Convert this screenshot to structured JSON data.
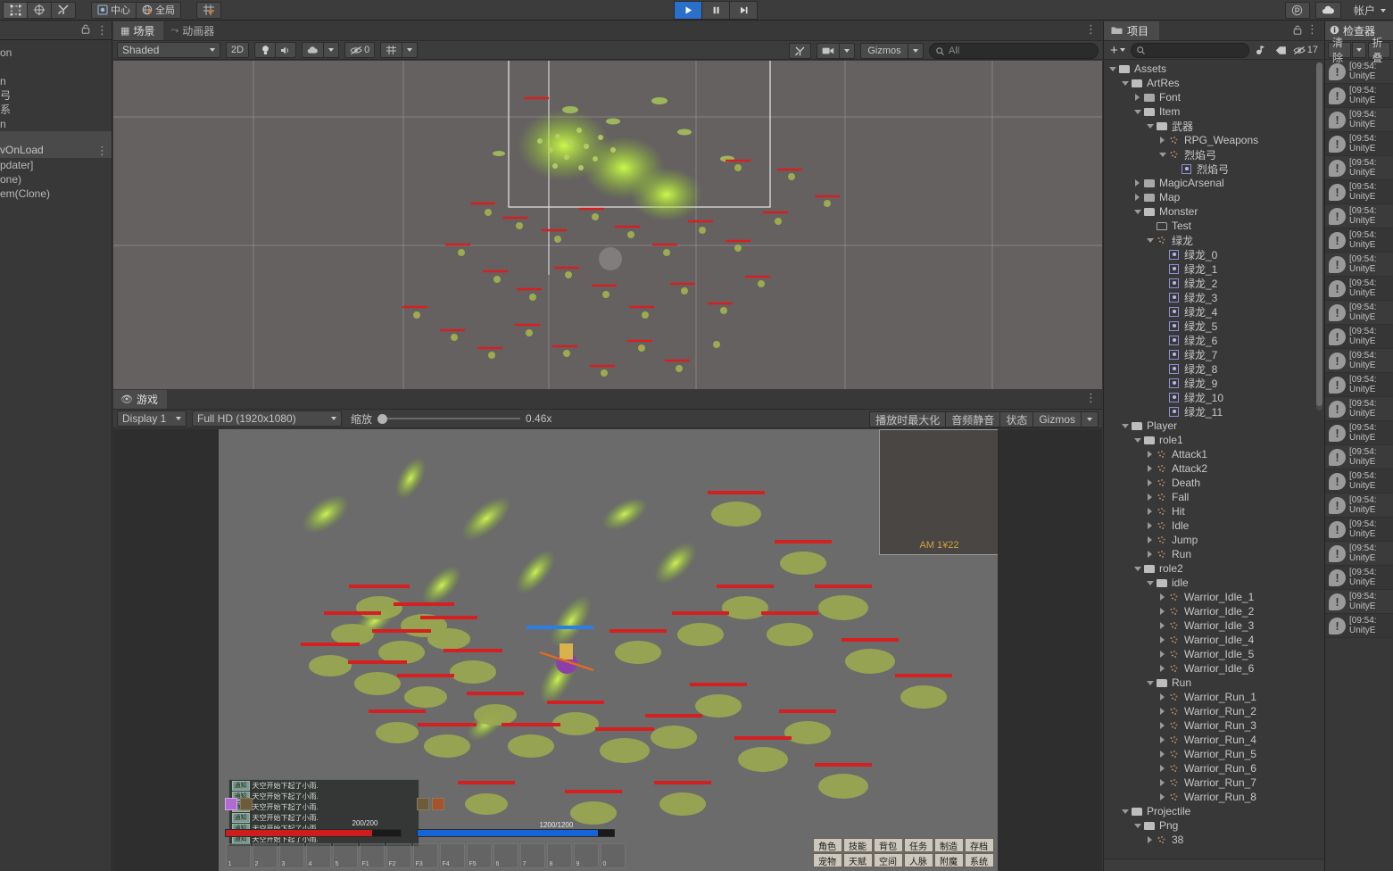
{
  "topbar": {
    "tools": [
      {
        "name": "rect-transform-tool",
        "icon": "▣"
      },
      {
        "name": "move-tool",
        "icon": "✥"
      },
      {
        "name": "custom-tool",
        "icon": "✂"
      }
    ],
    "pivot_label": "中心",
    "space_label": "全局",
    "grid_label": "▦",
    "play_icon": "▶",
    "pause_icon": "❚❚",
    "step_icon": "▶❙",
    "collab_icon": "◎",
    "cloud_icon": "☁",
    "account_label": "帐户"
  },
  "left_panel": {
    "rows_top": [
      "on",
      "",
      "n",
      "弓",
      "系",
      "n"
    ],
    "selected_row": "",
    "section_label": "vOnLoad",
    "rows_bottom": [
      "pdater]",
      "one)",
      "em(Clone)"
    ]
  },
  "scene_view": {
    "tabs": [
      {
        "label": "场景",
        "icon": "scene-icon",
        "active": true
      },
      {
        "label": "动画器",
        "icon": "animator-icon",
        "active": false
      }
    ],
    "shading_mode": "Shaded",
    "mode_2d": "2D",
    "lighting_icon": "💡",
    "audio_icon": "🔊",
    "fx_icon": "☁",
    "hidden_count": "0",
    "grid_icon": "▦",
    "gizmos_label": "Gizmos",
    "search_placeholder": "All",
    "search_value": "",
    "tool_icon": "✂",
    "camera_icon": "▮"
  },
  "game_view": {
    "tab_label": "游戏",
    "display": "Display 1",
    "resolution": "Full HD (1920x1080)",
    "zoom_label": "缩放",
    "zoom_value": "0.46x",
    "maximize_label": "播放时最大化",
    "mute_label": "音频静音",
    "stats_label": "状态",
    "gizmos_label": "Gizmos",
    "hud": {
      "minimap_label": "AM 1¥22",
      "chat_messages": [
        {
          "badge": "通知",
          "text": "天空开始下起了小雨."
        },
        {
          "badge": "通知",
          "text": "天空开始下起了小雨."
        },
        {
          "badge": "通知",
          "text": "天空开始下起了小雨."
        },
        {
          "badge": "通知",
          "text": "天空开始下起了小雨."
        },
        {
          "badge": "通知",
          "text": "天空开始下起了小雨."
        },
        {
          "badge": "通知",
          "text": "天空开始下起了小雨."
        }
      ],
      "hp_text": "200/200",
      "mp_text": "1200/1200",
      "skill_keys": [
        "1",
        "2",
        "3",
        "4",
        "5",
        "F1",
        "F2",
        "F3",
        "F4",
        "F5",
        "6",
        "7",
        "8",
        "9",
        "0"
      ],
      "menu_buttons": [
        "角色",
        "技能",
        "背包",
        "任务",
        "制造",
        "存档",
        "宠物",
        "天赋",
        "空间",
        "人脉",
        "附魔",
        "系统"
      ]
    }
  },
  "project_panel": {
    "tab_label": "项目",
    "search_placeholder": "",
    "search_value": "",
    "hidden_count": "17",
    "tree": [
      {
        "depth": 0,
        "label": "Assets",
        "type": "folder-open",
        "expanded": true
      },
      {
        "depth": 1,
        "label": "ArtRes",
        "type": "folder-open",
        "expanded": true
      },
      {
        "depth": 2,
        "label": "Font",
        "type": "folder",
        "expanded": false
      },
      {
        "depth": 2,
        "label": "Item",
        "type": "folder-open",
        "expanded": true
      },
      {
        "depth": 3,
        "label": "武器",
        "type": "folder-open",
        "expanded": true
      },
      {
        "depth": 4,
        "label": "RPG_Weapons",
        "type": "fx",
        "expanded": false
      },
      {
        "depth": 4,
        "label": "烈焰弓",
        "type": "fx",
        "expanded": true
      },
      {
        "depth": 5,
        "label": "烈焰弓",
        "type": "prefab",
        "expanded": null
      },
      {
        "depth": 2,
        "label": "MagicArsenal",
        "type": "folder",
        "expanded": false
      },
      {
        "depth": 2,
        "label": "Map",
        "type": "folder",
        "expanded": false
      },
      {
        "depth": 2,
        "label": "Monster",
        "type": "folder-open",
        "expanded": true
      },
      {
        "depth": 3,
        "label": "Test",
        "type": "folder-hollow",
        "expanded": null
      },
      {
        "depth": 3,
        "label": "绿龙",
        "type": "fx",
        "expanded": true
      },
      {
        "depth": 4,
        "label": "绿龙_0",
        "type": "prefab",
        "expanded": null
      },
      {
        "depth": 4,
        "label": "绿龙_1",
        "type": "prefab",
        "expanded": null
      },
      {
        "depth": 4,
        "label": "绿龙_2",
        "type": "prefab",
        "expanded": null
      },
      {
        "depth": 4,
        "label": "绿龙_3",
        "type": "prefab",
        "expanded": null
      },
      {
        "depth": 4,
        "label": "绿龙_4",
        "type": "prefab",
        "expanded": null
      },
      {
        "depth": 4,
        "label": "绿龙_5",
        "type": "prefab",
        "expanded": null
      },
      {
        "depth": 4,
        "label": "绿龙_6",
        "type": "prefab",
        "expanded": null
      },
      {
        "depth": 4,
        "label": "绿龙_7",
        "type": "prefab",
        "expanded": null
      },
      {
        "depth": 4,
        "label": "绿龙_8",
        "type": "prefab",
        "expanded": null
      },
      {
        "depth": 4,
        "label": "绿龙_9",
        "type": "prefab",
        "expanded": null
      },
      {
        "depth": 4,
        "label": "绿龙_10",
        "type": "prefab",
        "expanded": null
      },
      {
        "depth": 4,
        "label": "绿龙_11",
        "type": "prefab",
        "expanded": null
      },
      {
        "depth": 1,
        "label": "Player",
        "type": "folder-open",
        "expanded": true
      },
      {
        "depth": 2,
        "label": "role1",
        "type": "folder-open",
        "expanded": true
      },
      {
        "depth": 3,
        "label": "Attack1",
        "type": "fx",
        "expanded": false
      },
      {
        "depth": 3,
        "label": "Attack2",
        "type": "fx",
        "expanded": false
      },
      {
        "depth": 3,
        "label": "Death",
        "type": "fx",
        "expanded": false
      },
      {
        "depth": 3,
        "label": "Fall",
        "type": "fx",
        "expanded": false
      },
      {
        "depth": 3,
        "label": "Hit",
        "type": "fx",
        "expanded": false
      },
      {
        "depth": 3,
        "label": "Idle",
        "type": "fx",
        "expanded": false
      },
      {
        "depth": 3,
        "label": "Jump",
        "type": "fx",
        "expanded": false
      },
      {
        "depth": 3,
        "label": "Run",
        "type": "fx",
        "expanded": false
      },
      {
        "depth": 2,
        "label": "role2",
        "type": "folder-open",
        "expanded": true
      },
      {
        "depth": 3,
        "label": "idle",
        "type": "folder-open",
        "expanded": true
      },
      {
        "depth": 4,
        "label": "Warrior_Idle_1",
        "type": "fx",
        "expanded": false
      },
      {
        "depth": 4,
        "label": "Warrior_Idle_2",
        "type": "fx",
        "expanded": false
      },
      {
        "depth": 4,
        "label": "Warrior_Idle_3",
        "type": "fx",
        "expanded": false
      },
      {
        "depth": 4,
        "label": "Warrior_Idle_4",
        "type": "fx",
        "expanded": false
      },
      {
        "depth": 4,
        "label": "Warrior_Idle_5",
        "type": "fx",
        "expanded": false
      },
      {
        "depth": 4,
        "label": "Warrior_Idle_6",
        "type": "fx",
        "expanded": false
      },
      {
        "depth": 3,
        "label": "Run",
        "type": "folder-open",
        "expanded": true
      },
      {
        "depth": 4,
        "label": "Warrior_Run_1",
        "type": "fx",
        "expanded": false
      },
      {
        "depth": 4,
        "label": "Warrior_Run_2",
        "type": "fx",
        "expanded": false
      },
      {
        "depth": 4,
        "label": "Warrior_Run_3",
        "type": "fx",
        "expanded": false
      },
      {
        "depth": 4,
        "label": "Warrior_Run_4",
        "type": "fx",
        "expanded": false
      },
      {
        "depth": 4,
        "label": "Warrior_Run_5",
        "type": "fx",
        "expanded": false
      },
      {
        "depth": 4,
        "label": "Warrior_Run_6",
        "type": "fx",
        "expanded": false
      },
      {
        "depth": 4,
        "label": "Warrior_Run_7",
        "type": "fx",
        "expanded": false
      },
      {
        "depth": 4,
        "label": "Warrior_Run_8",
        "type": "fx",
        "expanded": false
      },
      {
        "depth": 1,
        "label": "Projectile",
        "type": "folder-open",
        "expanded": true
      },
      {
        "depth": 2,
        "label": "Png",
        "type": "folder-open",
        "expanded": true
      },
      {
        "depth": 3,
        "label": "38",
        "type": "fx",
        "expanded": false
      }
    ]
  },
  "console_panel": {
    "tab_label": "检查器",
    "clear_label": "清除",
    "collapse_label": "折叠",
    "rows": [
      {
        "time": "[09:54:",
        "source": "UnityE"
      },
      {
        "time": "[09:54:",
        "source": "UnityE"
      },
      {
        "time": "[09:54:",
        "source": "UnityE"
      },
      {
        "time": "[09:54:",
        "source": "UnityE"
      },
      {
        "time": "[09:54:",
        "source": "UnityE"
      },
      {
        "time": "[09:54:",
        "source": "UnityE"
      },
      {
        "time": "[09:54:",
        "source": "UnityE"
      },
      {
        "time": "[09:54:",
        "source": "UnityE"
      },
      {
        "time": "[09:54:",
        "source": "UnityE"
      },
      {
        "time": "[09:54:",
        "source": "UnityE"
      },
      {
        "time": "[09:54:",
        "source": "UnityE"
      },
      {
        "time": "[09:54:",
        "source": "UnityE"
      },
      {
        "time": "[09:54:",
        "source": "UnityE"
      },
      {
        "time": "[09:54:",
        "source": "UnityE"
      },
      {
        "time": "[09:54:",
        "source": "UnityE"
      },
      {
        "time": "[09:54:",
        "source": "UnityE"
      },
      {
        "time": "[09:54:",
        "source": "UnityE"
      },
      {
        "time": "[09:54:",
        "source": "UnityE"
      },
      {
        "time": "[09:54:",
        "source": "UnityE"
      },
      {
        "time": "[09:54:",
        "source": "UnityE"
      },
      {
        "time": "[09:54:",
        "source": "UnityE"
      },
      {
        "time": "[09:54:",
        "source": "UnityE"
      },
      {
        "time": "[09:54:",
        "source": "UnityE"
      },
      {
        "time": "[09:54:",
        "source": "UnityE"
      }
    ]
  },
  "colors": {
    "chrome": "#383838",
    "toolbar": "#3c3c3c",
    "accent_blue": "#2a6fc9",
    "scene_bg": "#656161",
    "game_bg": "#6b6b6b",
    "prefab_blue": "#8f8fd8",
    "hp_red": "#cf1c1c",
    "mp_blue": "#1565d8"
  }
}
